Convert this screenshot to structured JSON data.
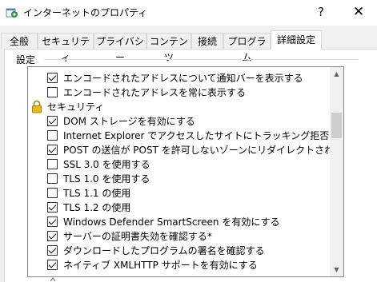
{
  "window": {
    "title": "インターネットのプロパティ",
    "help": "?",
    "close": "✕"
  },
  "tabs": [
    "全般",
    "セキュリティ",
    "プライバシー",
    "コンテンツ",
    "接続",
    "プログラム",
    "詳細設定"
  ],
  "active_tab": "詳細設定",
  "group": {
    "label": "設定"
  },
  "list": {
    "items": [
      {
        "label": "エンコードされたアドレスについて通知バーを表示する",
        "checked": true,
        "category": false
      },
      {
        "label": "エンコードされたアドレスを常に表示する",
        "checked": false,
        "category": false
      },
      {
        "label": "セキュリティ",
        "category": true,
        "icon": "lock-icon"
      },
      {
        "label": "DOM ストレージを有効にする",
        "checked": true,
        "category": false
      },
      {
        "label": "Internet Explorer でアクセスしたサイトにトラッキング拒否要求を送信す",
        "checked": false,
        "category": false
      },
      {
        "label": "POST の送信が POST を許可しないゾーンにリダイレクトされた場合に警告",
        "checked": true,
        "category": false
      },
      {
        "label": "SSL 3.0 を使用する",
        "checked": false,
        "category": false
      },
      {
        "label": "TLS 1.0 を使用する",
        "checked": false,
        "category": false
      },
      {
        "label": "TLS 1.1 の使用",
        "checked": false,
        "category": false
      },
      {
        "label": "TLS 1.2 の使用",
        "checked": true,
        "category": false
      },
      {
        "label": "Windows Defender SmartScreen を有効にする",
        "checked": true,
        "category": false
      },
      {
        "label": "サーバーの証明書失効を確認する*",
        "checked": true,
        "category": false
      },
      {
        "label": "ダウンロードしたプログラムの署名を確認する",
        "checked": true,
        "category": false
      },
      {
        "label": "ネイティブ XMLHTTP サポートを有効にする",
        "checked": true,
        "category": false
      }
    ]
  },
  "scrollbar": {
    "position_fraction": 0.27
  }
}
